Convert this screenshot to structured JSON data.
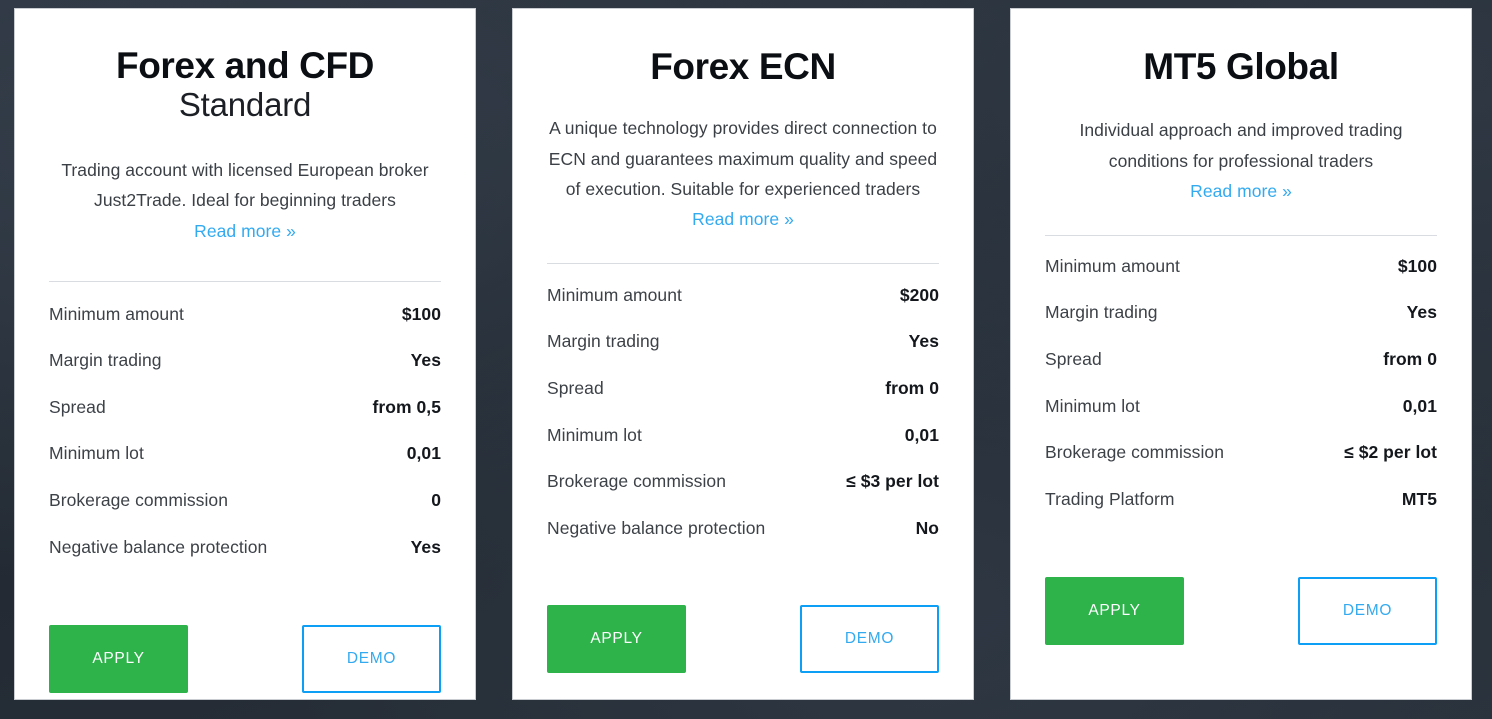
{
  "theme": {
    "background_color": "#272f39",
    "card_background": "#ffffff",
    "card_border": "#c9ccd1",
    "link_color": "#33aaf0",
    "apply_color": "#2eb24a",
    "demo_border_color": "#0d9ef5",
    "label_color": "#3d4248",
    "value_color": "#14181d",
    "divider_color": "#d9dce0"
  },
  "cards": [
    {
      "title": "Forex and CFD",
      "subtitle": "Standard",
      "description": "Trading account with licensed European broker Just2Trade. Ideal for beginning traders",
      "read_more": "Read more »",
      "features": [
        {
          "label": "Minimum amount",
          "value": "$100"
        },
        {
          "label": "Margin trading",
          "value": "Yes"
        },
        {
          "label": "Spread",
          "value": "from 0,5"
        },
        {
          "label": "Minimum lot",
          "value": "0,01"
        },
        {
          "label": "Brokerage commission",
          "value": "0"
        },
        {
          "label": "Negative balance protection",
          "value": "Yes"
        }
      ],
      "apply_label": "APPLY",
      "demo_label": "DEMO"
    },
    {
      "title": "Forex ECN",
      "subtitle": "",
      "description": "A unique technology provides direct connection to ECN and guarantees maximum quality and speed of execution. Suitable for experienced traders",
      "read_more": "Read more »",
      "features": [
        {
          "label": "Minimum amount",
          "value": "$200"
        },
        {
          "label": "Margin trading",
          "value": "Yes"
        },
        {
          "label": "Spread",
          "value": "from 0"
        },
        {
          "label": "Minimum lot",
          "value": "0,01"
        },
        {
          "label": "Brokerage commission",
          "value": "≤ $3 per lot"
        },
        {
          "label": "Negative balance protection",
          "value": "No"
        }
      ],
      "apply_label": "APPLY",
      "demo_label": "DEMO"
    },
    {
      "title": "MT5 Global",
      "subtitle": "",
      "description": "Individual approach and improved trading conditions for professional traders",
      "read_more": "Read more »",
      "features": [
        {
          "label": "Minimum amount",
          "value": "$100"
        },
        {
          "label": "Margin trading",
          "value": "Yes"
        },
        {
          "label": "Spread",
          "value": "from 0"
        },
        {
          "label": "Minimum lot",
          "value": "0,01"
        },
        {
          "label": "Brokerage commission",
          "value": "≤ $2 per lot"
        },
        {
          "label": "Trading Platform",
          "value": "MT5"
        }
      ],
      "apply_label": "APPLY",
      "demo_label": "DEMO"
    }
  ]
}
